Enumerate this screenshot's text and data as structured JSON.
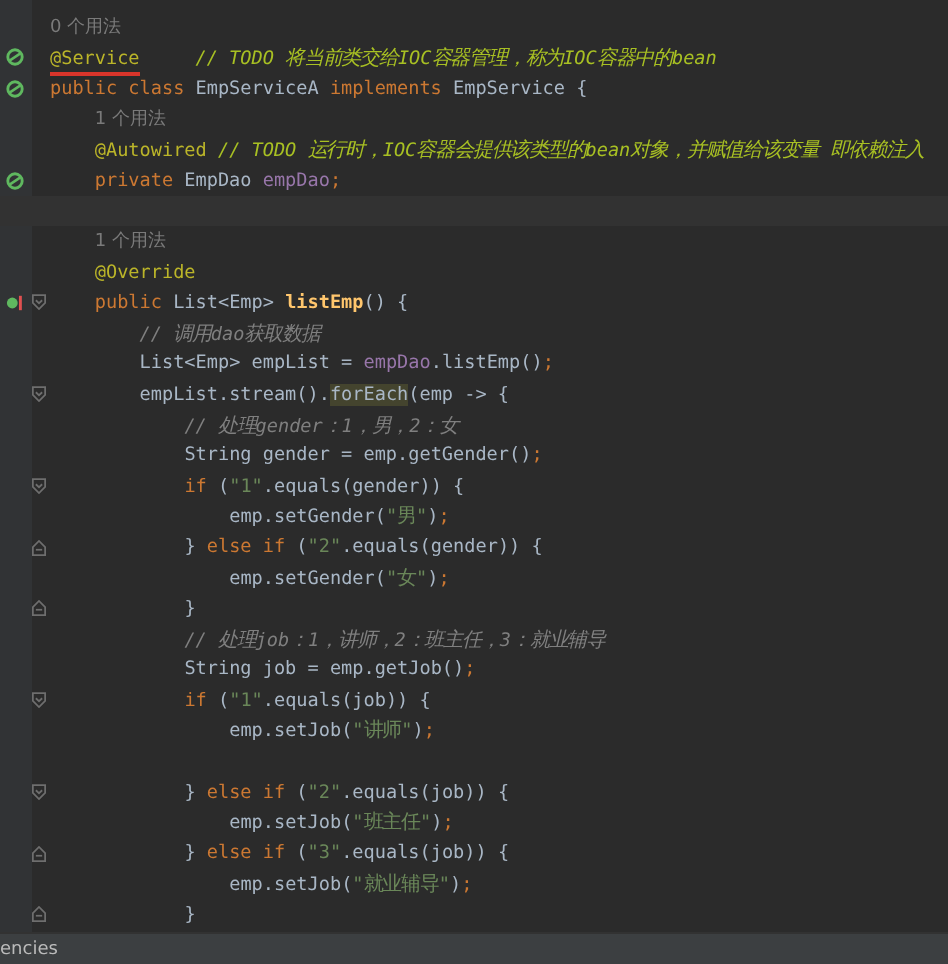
{
  "editor": {
    "lines": [
      {
        "kind": "hint",
        "text": "0 个用法"
      },
      {
        "kind": "code",
        "bean": true,
        "tokens": [
          {
            "kind": "annotation",
            "text": "@Service",
            "underline": true
          },
          {
            "kind": "todo",
            "text": "     // TODO 将当前类交给IOC容器管理，称为IOC容器中的bean"
          }
        ]
      },
      {
        "kind": "code",
        "bean": true,
        "tokens": [
          {
            "kind": "keyword",
            "text": "public class "
          },
          {
            "kind": "plain",
            "text": "EmpServiceA "
          },
          {
            "kind": "keyword",
            "text": "implements "
          },
          {
            "kind": "plain",
            "text": "EmpService {"
          }
        ],
        "children": [
          {
            "kind": "hint",
            "text": "1 个用法"
          },
          {
            "kind": "code",
            "tokens": [
              {
                "kind": "annotation",
                "text": "@Autowired",
                "underline": false
              },
              {
                "kind": "todo",
                "text": " // TODO 运行时，IOC容器会提供该类型的bean对象，并赋值给该变量 即依赖注入"
              }
            ]
          },
          {
            "kind": "code",
            "bean": true,
            "tokens": [
              {
                "kind": "keyword",
                "text": "private "
              },
              {
                "kind": "plain",
                "text": "EmpDao "
              },
              {
                "kind": "field",
                "text": "empDao"
              },
              {
                "kind": "keyword",
                "text": ";"
              }
            ]
          },
          {
            "kind": "code",
            "current": true
          },
          {
            "kind": "hint",
            "text": "1 个用法"
          },
          {
            "kind": "code",
            "tokens": [
              {
                "kind": "annotation",
                "text": "@Override"
              }
            ]
          },
          {
            "kind": "code",
            "override": true,
            "fold_start": true,
            "tokens": [
              {
                "kind": "keyword",
                "text": "public "
              },
              {
                "kind": "plain",
                "text": "List<Emp> "
              },
              {
                "kind": "method",
                "text": "listEmp"
              },
              {
                "kind": "plain",
                "text": "() {"
              }
            ],
            "children": [
              {
                "kind": "code",
                "tokens": [
                  {
                    "kind": "comment",
                    "text": "// 调用dao获取数据"
                  }
                ]
              },
              {
                "kind": "code",
                "tokens": [
                  {
                    "kind": "plain",
                    "text": "List<Emp> empList = "
                  },
                  {
                    "kind": "field",
                    "text": "empDao"
                  },
                  {
                    "kind": "plain",
                    "text": ".listEmp()"
                  },
                  {
                    "kind": "keyword",
                    "text": ";"
                  }
                ]
              },
              {
                "kind": "code",
                "fold_start": true,
                "tokens": [
                  {
                    "kind": "plain",
                    "text": "empList.stream()."
                  },
                  {
                    "kind": "match",
                    "text": "forEach"
                  },
                  {
                    "kind": "plain",
                    "text": "(emp -> {"
                  }
                ],
                "children": [
                  {
                    "kind": "code",
                    "tokens": [
                      {
                        "kind": "comment",
                        "text": "// 处理gender：1，男，2：女"
                      }
                    ]
                  },
                  {
                    "kind": "code",
                    "tokens": [
                      {
                        "kind": "plain",
                        "text": "String gender = emp.getGender()"
                      },
                      {
                        "kind": "keyword",
                        "text": ";"
                      }
                    ]
                  },
                  {
                    "kind": "code",
                    "fold_start": true,
                    "tokens": [
                      {
                        "kind": "keyword",
                        "text": "if "
                      },
                      {
                        "kind": "plain",
                        "text": "("
                      },
                      {
                        "kind": "string",
                        "text": "\"1\""
                      },
                      {
                        "kind": "plain",
                        "text": ".equals(gender)) {"
                      }
                    ],
                    "children": [
                      {
                        "kind": "code",
                        "tokens": [
                          {
                            "kind": "plain",
                            "text": "emp.setGender("
                          },
                          {
                            "kind": "string",
                            "text": "\"男\""
                          },
                          {
                            "kind": "plain",
                            "text": ")"
                          },
                          {
                            "kind": "keyword",
                            "text": ";"
                          }
                        ]
                      }
                    ]
                  },
                  {
                    "kind": "code",
                    "fold_end": true,
                    "tokens": [
                      {
                        "kind": "plain",
                        "text": "} "
                      },
                      {
                        "kind": "keyword",
                        "text": "else if "
                      },
                      {
                        "kind": "plain",
                        "text": "("
                      },
                      {
                        "kind": "string",
                        "text": "\"2\""
                      },
                      {
                        "kind": "plain",
                        "text": ".equals(gender)) {"
                      }
                    ],
                    "children": [
                      {
                        "kind": "code",
                        "tokens": [
                          {
                            "kind": "plain",
                            "text": "emp.setGender("
                          },
                          {
                            "kind": "string",
                            "text": "\"女\""
                          },
                          {
                            "kind": "plain",
                            "text": ")"
                          },
                          {
                            "kind": "keyword",
                            "text": ";"
                          }
                        ]
                      }
                    ]
                  },
                  {
                    "kind": "code",
                    "fold_end": true,
                    "tokens": [
                      {
                        "kind": "plain",
                        "text": "}"
                      }
                    ]
                  },
                  {
                    "kind": "code",
                    "tokens": [
                      {
                        "kind": "comment",
                        "text": "// 处理job：1，讲师，2：班主任，3：就业辅导"
                      }
                    ]
                  },
                  {
                    "kind": "code",
                    "tokens": [
                      {
                        "kind": "plain",
                        "text": "String job = emp.getJob()"
                      },
                      {
                        "kind": "keyword",
                        "text": ";"
                      }
                    ]
                  },
                  {
                    "kind": "code",
                    "fold_start": true,
                    "tokens": [
                      {
                        "kind": "keyword",
                        "text": "if "
                      },
                      {
                        "kind": "plain",
                        "text": "("
                      },
                      {
                        "kind": "string",
                        "text": "\"1\""
                      },
                      {
                        "kind": "plain",
                        "text": ".equals(job)) {"
                      }
                    ],
                    "children": [
                      {
                        "kind": "code",
                        "tokens": [
                          {
                            "kind": "plain",
                            "text": "emp.setJob("
                          },
                          {
                            "kind": "string",
                            "text": "\"讲师\""
                          },
                          {
                            "kind": "plain",
                            "text": ")"
                          },
                          {
                            "kind": "keyword",
                            "text": ";"
                          }
                        ]
                      },
                      {
                        "kind": "code"
                      }
                    ]
                  },
                  {
                    "kind": "code",
                    "fold_start": true,
                    "tokens": [
                      {
                        "kind": "plain",
                        "text": "} "
                      },
                      {
                        "kind": "keyword",
                        "text": "else if "
                      },
                      {
                        "kind": "plain",
                        "text": "("
                      },
                      {
                        "kind": "string",
                        "text": "\"2\""
                      },
                      {
                        "kind": "plain",
                        "text": ".equals(job)) {"
                      }
                    ],
                    "children": [
                      {
                        "kind": "code",
                        "tokens": [
                          {
                            "kind": "plain",
                            "text": "emp.setJob("
                          },
                          {
                            "kind": "string",
                            "text": "\"班主任\""
                          },
                          {
                            "kind": "plain",
                            "text": ")"
                          },
                          {
                            "kind": "keyword",
                            "text": ";"
                          }
                        ]
                      }
                    ]
                  },
                  {
                    "kind": "code",
                    "fold_end": true,
                    "tokens": [
                      {
                        "kind": "plain",
                        "text": "} "
                      },
                      {
                        "kind": "keyword",
                        "text": "else if "
                      },
                      {
                        "kind": "plain",
                        "text": "("
                      },
                      {
                        "kind": "string",
                        "text": "\"3\""
                      },
                      {
                        "kind": "plain",
                        "text": ".equals(job)) {"
                      }
                    ],
                    "children": [
                      {
                        "kind": "code",
                        "tokens": [
                          {
                            "kind": "plain",
                            "text": "emp.setJob("
                          },
                          {
                            "kind": "string",
                            "text": "\"就业辅导\""
                          },
                          {
                            "kind": "plain",
                            "text": ")"
                          },
                          {
                            "kind": "keyword",
                            "text": ";"
                          }
                        ]
                      }
                    ]
                  },
                  {
                    "kind": "code",
                    "fold_end": true,
                    "tokens": [
                      {
                        "kind": "plain",
                        "text": "}"
                      }
                    ]
                  }
                ]
              }
            ]
          }
        ]
      }
    ]
  },
  "status_bar": {
    "text": "encies"
  }
}
